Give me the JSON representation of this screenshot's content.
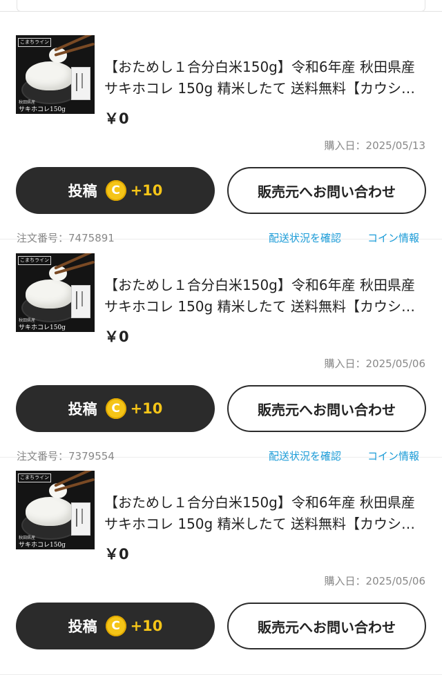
{
  "product": {
    "thumb_banner": "こまちライン",
    "thumb_pref": "秋田県産",
    "thumb_brand": "サキホコレ150g"
  },
  "labels": {
    "date_prefix": "購入日：",
    "order_prefix": "注文番号：",
    "post_button": "投稿",
    "coin_symbol": "C",
    "contact_button": "販売元へお問い合わせ",
    "track_link": "配送状況を確認",
    "coin_link": "コイン情報"
  },
  "colors": {
    "accent_link": "#1a9bd7",
    "coin": "#f5c518",
    "dark_button": "#2b2b2b"
  },
  "orders": [
    {
      "title": "【おためし１合分白米150g】令和6年産 秋田県産 サキホコレ 150g 精米したて 送料無料【カウシ…",
      "price": "￥0",
      "purchase_date": "2025/05/13",
      "coin_amount": "+10",
      "order_number": "7475891"
    },
    {
      "title": "【おためし１合分白米150g】令和6年産 秋田県産 サキホコレ 150g 精米したて 送料無料【カウシ…",
      "price": "￥0",
      "purchase_date": "2025/05/06",
      "coin_amount": "+10",
      "order_number": "7379554"
    },
    {
      "title": "【おためし１合分白米150g】令和6年産 秋田県産 サキホコレ 150g 精米したて 送料無料【カウシ…",
      "price": "￥0",
      "purchase_date": "2025/05/06",
      "coin_amount": "+10",
      "order_number": ""
    }
  ]
}
